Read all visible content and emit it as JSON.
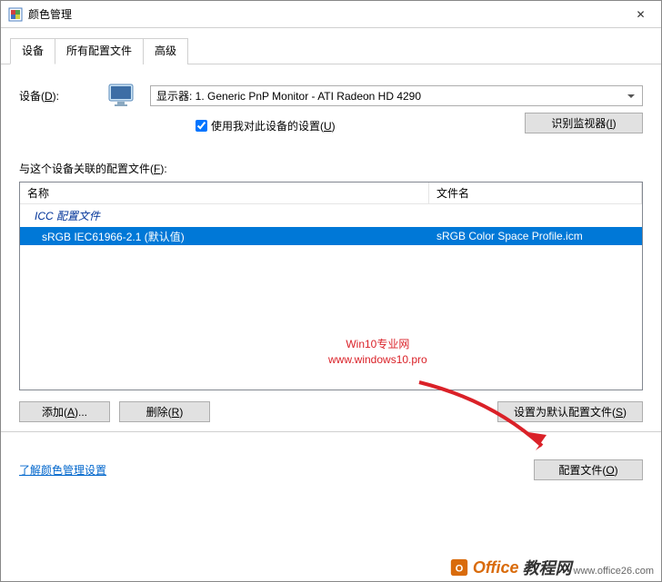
{
  "window": {
    "title": "颜色管理",
    "close_glyph": "✕"
  },
  "tabs": {
    "t0": "设备",
    "t1": "所有配置文件",
    "t2": "高级"
  },
  "device": {
    "label_prefix": "设备(",
    "label_key": "D",
    "label_suffix": "):",
    "selected": "显示器: 1. Generic PnP Monitor - ATI Radeon HD 4290",
    "checkbox_prefix": "使用我对此设备的设置(",
    "checkbox_key": "U",
    "checkbox_suffix": ")",
    "identify_btn_prefix": "识别监视器(",
    "identify_btn_key": "I",
    "identify_btn_suffix": ")"
  },
  "assoc": {
    "label_prefix": "与这个设备关联的配置文件(",
    "label_key": "F",
    "label_suffix": "):"
  },
  "list": {
    "col_name": "名称",
    "col_file": "文件名",
    "group": "ICC 配置文件",
    "row0_name": "sRGB IEC61966-2.1 (默认值)",
    "row0_file": "sRGB Color Space Profile.icm"
  },
  "buttons": {
    "add_prefix": "添加(",
    "add_key": "A",
    "add_suffix": ")...",
    "remove_prefix": "删除(",
    "remove_key": "R",
    "remove_suffix": ")",
    "setdefault_prefix": "设置为默认配置文件(",
    "setdefault_key": "S",
    "setdefault_suffix": ")",
    "link": "了解颜色管理设置",
    "profiles_prefix": "配置文件(",
    "profiles_key": "O",
    "profiles_suffix": ")"
  },
  "watermark": {
    "line1": "Win10专业网",
    "line2": "www.windows10.pro"
  },
  "footer": {
    "brand1": "Office",
    "brand2": "教程网",
    "url": "www.office26.com"
  }
}
